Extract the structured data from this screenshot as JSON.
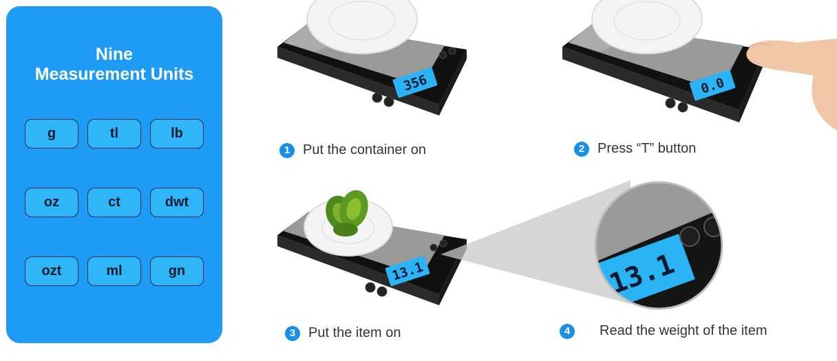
{
  "units_panel": {
    "title_line1": "Nine",
    "title_line2": "Measurement Units",
    "units": [
      "g",
      "tl",
      "lb",
      "oz",
      "ct",
      "dwt",
      "ozt",
      "ml",
      "gn"
    ]
  },
  "steps": [
    {
      "number": "1",
      "label": "Put the container on",
      "display": "356"
    },
    {
      "number": "2",
      "label": "Press “T” button",
      "display": "0.0"
    },
    {
      "number": "3",
      "label": "Put the item on",
      "display": "13.1"
    },
    {
      "number": "4",
      "label": "Read the weight of the item",
      "display": "13.1"
    }
  ],
  "colors": {
    "panel": "#1e9bf4",
    "chip": "#2fb6f8",
    "badge": "#1a8fe8",
    "lcd": "#2ab4f6"
  }
}
